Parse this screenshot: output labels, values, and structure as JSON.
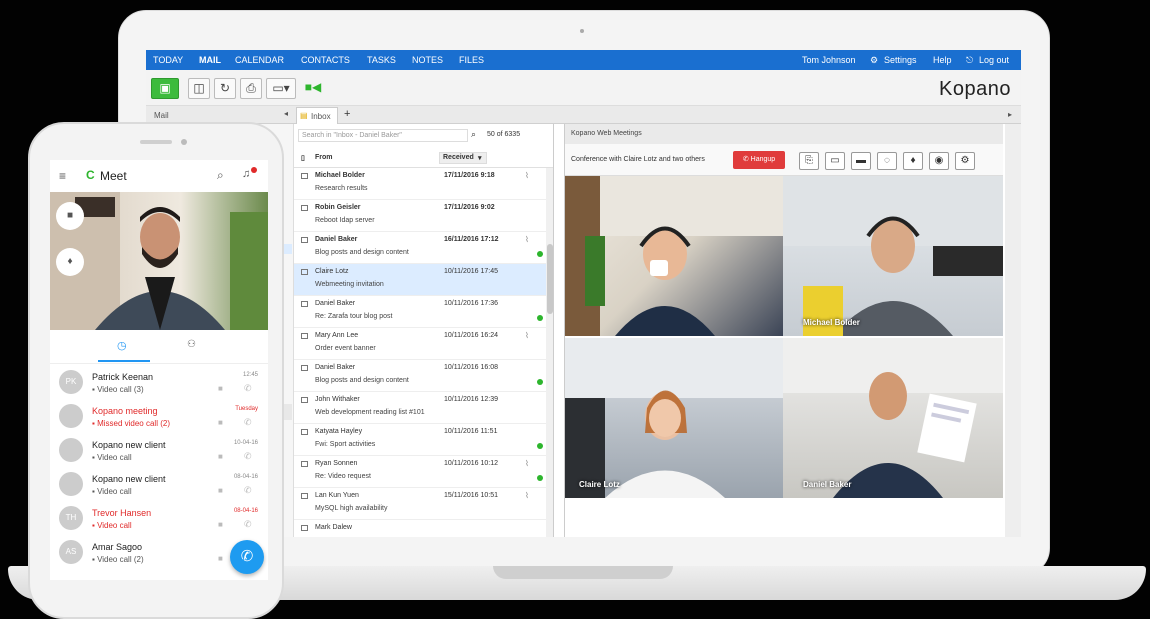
{
  "nav": {
    "items": [
      "TODAY",
      "MAIL",
      "CALENDAR",
      "CONTACTS",
      "TASKS",
      "NOTES",
      "FILES"
    ],
    "active": "MAIL",
    "user": "Tom Johnson",
    "settings": "Settings",
    "help": "Help",
    "logout": "Log out"
  },
  "brand": {
    "logo": "Kopano",
    "accent": "#1a6fd0",
    "active_green": "#3dbb3d",
    "hangup_red": "#e03c3c"
  },
  "tabs": {
    "mail_label": "Mail",
    "inbox_tab": "Inbox"
  },
  "list": {
    "search_placeholder": "Search in \"Inbox - Daniel Baker\"",
    "count": "50 of 6335",
    "col_from": "From",
    "col_received": "Received",
    "rows": [
      {
        "from": "Michael Bolder",
        "subject": "Research results",
        "date": "17/11/2016 9:18",
        "unread": true,
        "attach": true,
        "green": false
      },
      {
        "from": "Robin Geisler",
        "subject": "Reboot Idap server",
        "date": "17/11/2016 9:02",
        "unread": true,
        "attach": false,
        "green": false
      },
      {
        "from": "Daniel Baker",
        "subject": "Blog posts and design content",
        "date": "16/11/2016 17:12",
        "unread": true,
        "attach": true,
        "green": true
      },
      {
        "from": "Claire Lotz",
        "subject": "Webmeeting invitation",
        "date": "10/11/2016 17:45",
        "unread": false,
        "attach": false,
        "green": false,
        "selected": true
      },
      {
        "from": "Daniel Baker",
        "subject": "Re: Zarafa tour blog post",
        "date": "10/11/2016 17:36",
        "unread": false,
        "attach": false,
        "green": true
      },
      {
        "from": "Mary Ann Lee",
        "subject": "Order event banner",
        "date": "10/11/2016 16:24",
        "unread": false,
        "attach": true,
        "green": false
      },
      {
        "from": "Daniel Baker",
        "subject": "Blog posts and design content",
        "date": "10/11/2016 16:08",
        "unread": false,
        "attach": false,
        "green": true
      },
      {
        "from": "John Withaker",
        "subject": "Web development reading list #101",
        "date": "10/11/2016 12:39",
        "unread": false,
        "attach": false,
        "green": false
      },
      {
        "from": "Katyata Hayley",
        "subject": "Fwi: Sport activities",
        "date": "10/11/2016 11:51",
        "unread": false,
        "attach": false,
        "green": true
      },
      {
        "from": "Ryan Sonnen",
        "subject": "Re: Video request",
        "date": "10/11/2016 10:12",
        "unread": false,
        "attach": true,
        "green": true
      },
      {
        "from": "Lan Kun Yuen",
        "subject": "MySQL high availability",
        "date": "15/11/2016 10:51",
        "unread": false,
        "attach": true,
        "green": false
      },
      {
        "from": "Mark Dalew",
        "subject": "",
        "date": "",
        "unread": false,
        "attach": false,
        "green": false
      }
    ]
  },
  "meeting": {
    "panel_title": "Kopano Web Meetings",
    "conference": "Conference with Claire Lotz and two others",
    "hangup": "Hangup",
    "participants": [
      "Michael Bolder",
      "Claire Lotz",
      "Daniel Baker"
    ]
  },
  "phone": {
    "app_title": "Meet",
    "calls": [
      {
        "initials": "PK",
        "name": "Patrick Keenan",
        "status": "Video call (3)",
        "time": "12:45",
        "missed": false
      },
      {
        "initials": "",
        "name": "Kopano meeting",
        "status": "Missed video call (2)",
        "time": "Tuesday",
        "missed": true
      },
      {
        "initials": "",
        "name": "Kopano new client",
        "status": "Video call",
        "time": "10-04-16",
        "missed": false
      },
      {
        "initials": "",
        "name": "Kopano new client",
        "status": "Video call",
        "time": "08-04-16",
        "missed": false
      },
      {
        "initials": "TH",
        "name": "Trevor Hansen",
        "status": "Video call",
        "time": "08-04-16",
        "missed": true
      },
      {
        "initials": "AS",
        "name": "Amar Sagoo",
        "status": "Video call (2)",
        "time": "",
        "missed": false
      }
    ]
  }
}
